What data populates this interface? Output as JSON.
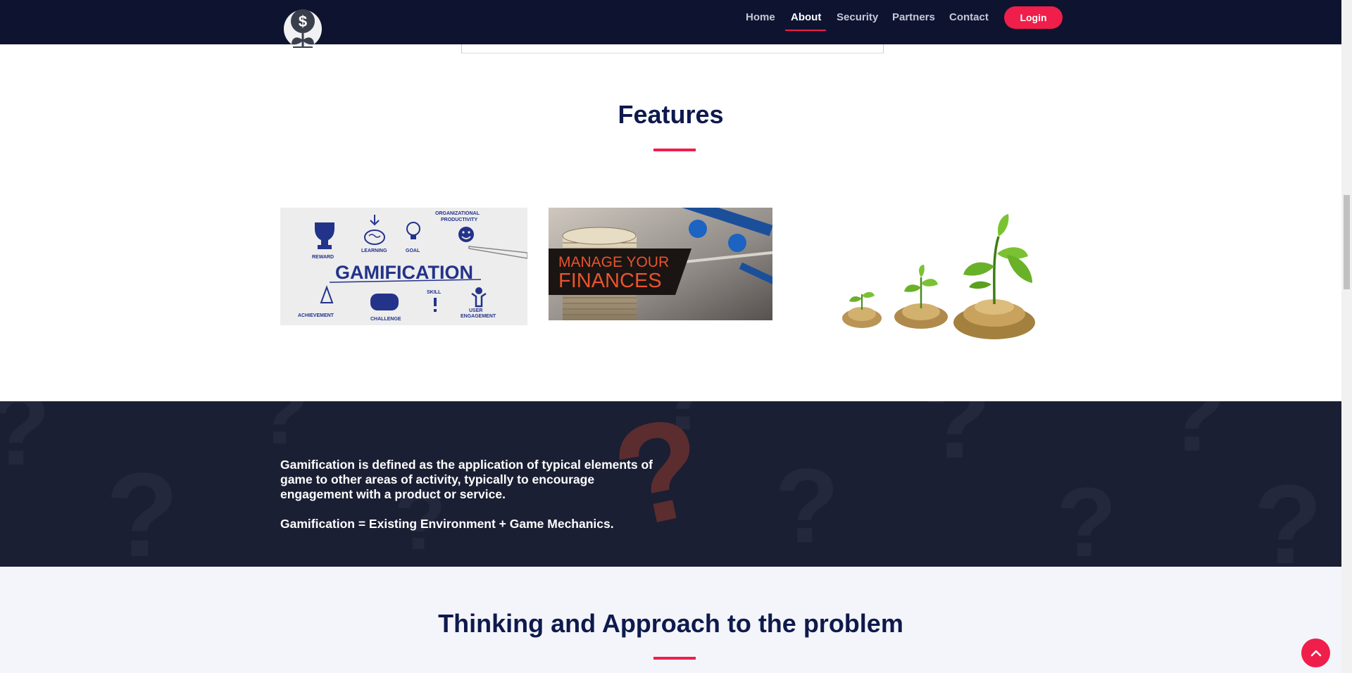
{
  "nav": {
    "items": [
      {
        "label": "Home"
      },
      {
        "label": "About"
      },
      {
        "label": "Security"
      },
      {
        "label": "Partners"
      },
      {
        "label": "Contact"
      }
    ],
    "active": "About",
    "login_label": "Login",
    "logo_icon": "dollar-plant-icon"
  },
  "features": {
    "title": "Features",
    "cards": [
      {
        "name": "gamification-image",
        "title": "GAMIFICATION",
        "labels": [
          "REWARD",
          "LEARNING",
          "GOAL",
          "ORGANIZATIONAL",
          "PRODUCTIVITY",
          "ACHIEVEMENT",
          "CHALLENGE",
          "SKILL",
          "USER",
          "ENGAGEMENT"
        ]
      },
      {
        "name": "manage-finances-image",
        "line1": "MANAGE YOUR",
        "line2": "FINANCES"
      },
      {
        "name": "coin-plants-image"
      }
    ]
  },
  "band": {
    "paragraph1": "Gamification is defined as the application of typical elements of game to other areas of activity, typically to encourage engagement with a product or service.",
    "paragraph2": "Gamification = Existing Environment + Game Mechanics."
  },
  "approach": {
    "title": "Thinking and Approach to the problem"
  },
  "colors": {
    "navy": "#0e1330",
    "accent": "#ef1e4a",
    "title": "#0e1a4d",
    "band": "#1a1f33"
  },
  "back_to_top_icon": "chevron-up-icon"
}
